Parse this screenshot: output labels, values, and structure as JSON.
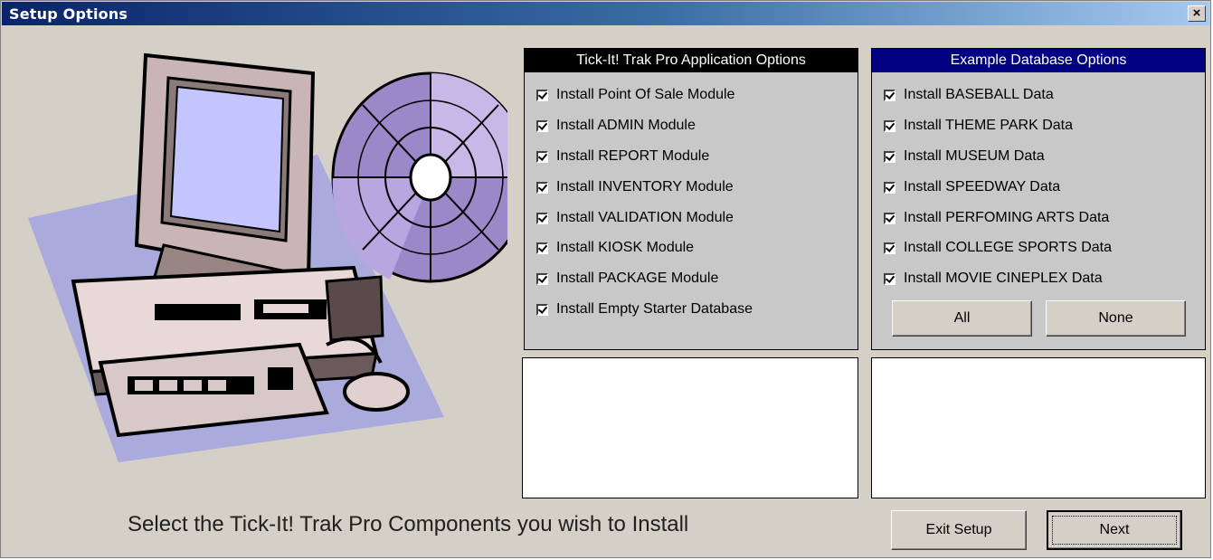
{
  "window": {
    "title": "Setup Options",
    "close_symbol": "×"
  },
  "illustration": {
    "icon": "computer-with-cd-clipart"
  },
  "app_options": {
    "header": "Tick-It! Trak Pro Application Options",
    "items": [
      {
        "label": "Install Point Of Sale Module",
        "checked": true
      },
      {
        "label": "Install ADMIN Module",
        "checked": true
      },
      {
        "label": "Install REPORT Module",
        "checked": true
      },
      {
        "label": "Install INVENTORY Module",
        "checked": true
      },
      {
        "label": "Install VALIDATION Module",
        "checked": true
      },
      {
        "label": "Install KIOSK Module",
        "checked": true
      },
      {
        "label": "Install PACKAGE Module",
        "checked": true
      },
      {
        "label": "Install Empty Starter Database",
        "checked": true
      }
    ]
  },
  "db_options": {
    "header": "Example Database Options",
    "items": [
      {
        "label": "Install BASEBALL Data",
        "checked": true
      },
      {
        "label": "Install THEME PARK Data",
        "checked": true
      },
      {
        "label": "Install MUSEUM Data",
        "checked": true
      },
      {
        "label": "Install SPEEDWAY Data",
        "checked": true
      },
      {
        "label": "Install PERFOMING ARTS Data",
        "checked": true
      },
      {
        "label": "Install COLLEGE SPORTS Data",
        "checked": true
      },
      {
        "label": "Install MOVIE CINEPLEX Data",
        "checked": true
      }
    ],
    "all_label": "All",
    "none_label": "None"
  },
  "footer": {
    "instruction": "Select the Tick-It! Trak Pro Components you wish to Install",
    "exit_label": "Exit Setup",
    "next_label": "Next"
  },
  "colors": {
    "titlebar_start": "#0a246a",
    "titlebar_end": "#a6caf0",
    "db_header": "#000080",
    "app_header": "#000000",
    "window_bg": "#d4d0c8"
  }
}
